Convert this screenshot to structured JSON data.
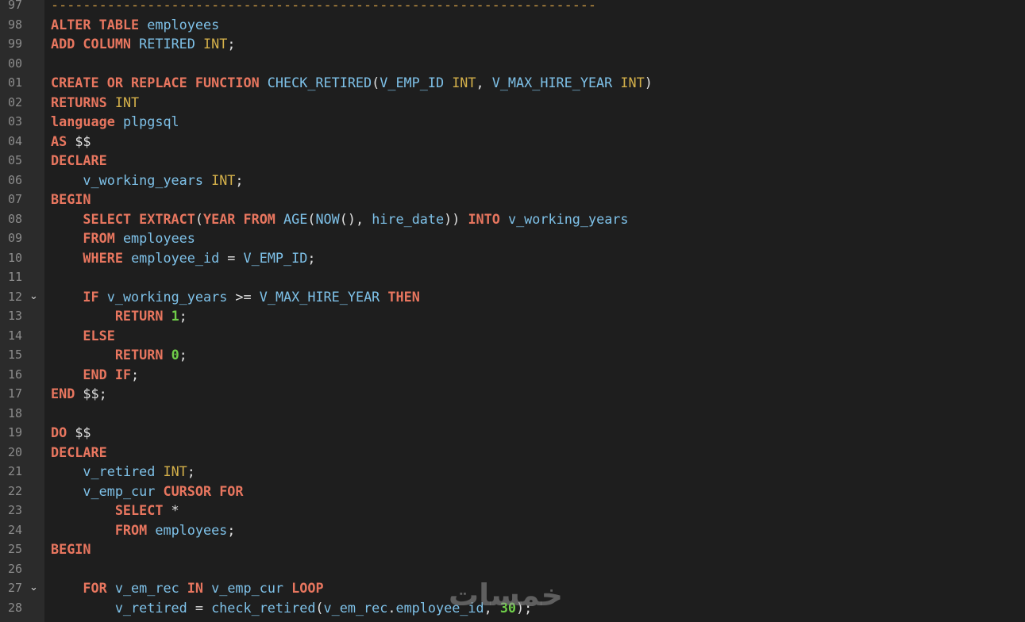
{
  "editor": {
    "colors": {
      "background": "#1e1e1e",
      "gutter": "#2b2b2b",
      "keyword": "#e8765f",
      "type": "#d4b04a",
      "identifier": "#7ec1e8",
      "number": "#6fce49",
      "plain": "#e0e0e0",
      "comment": "#cc9944"
    },
    "fold_icon": "chevron-down-icon",
    "lines": [
      {
        "n": "97",
        "fold": false,
        "tokens": [
          {
            "t": "cm",
            "v": "--------------------------------------------------------------------"
          }
        ]
      },
      {
        "n": "98",
        "fold": false,
        "tokens": [
          {
            "t": "kw",
            "v": "ALTER TABLE"
          },
          {
            "t": "pl",
            "v": " "
          },
          {
            "t": "id",
            "v": "employees"
          }
        ]
      },
      {
        "n": "99",
        "fold": false,
        "tokens": [
          {
            "t": "kw",
            "v": "ADD COLUMN"
          },
          {
            "t": "pl",
            "v": " "
          },
          {
            "t": "id",
            "v": "RETIRED"
          },
          {
            "t": "pl",
            "v": " "
          },
          {
            "t": "ty",
            "v": "INT"
          },
          {
            "t": "pl",
            "v": ";"
          }
        ]
      },
      {
        "n": "00",
        "fold": false,
        "tokens": []
      },
      {
        "n": "01",
        "fold": false,
        "tokens": [
          {
            "t": "kw",
            "v": "CREATE OR REPLACE FUNCTION"
          },
          {
            "t": "pl",
            "v": " "
          },
          {
            "t": "id",
            "v": "CHECK_RETIRED"
          },
          {
            "t": "pl",
            "v": "("
          },
          {
            "t": "id",
            "v": "V_EMP_ID"
          },
          {
            "t": "pl",
            "v": " "
          },
          {
            "t": "ty",
            "v": "INT"
          },
          {
            "t": "pl",
            "v": ", "
          },
          {
            "t": "id",
            "v": "V_MAX_HIRE_YEAR"
          },
          {
            "t": "pl",
            "v": " "
          },
          {
            "t": "ty",
            "v": "INT"
          },
          {
            "t": "pl",
            "v": ")"
          }
        ]
      },
      {
        "n": "02",
        "fold": false,
        "tokens": [
          {
            "t": "kw",
            "v": "RETURNS"
          },
          {
            "t": "pl",
            "v": " "
          },
          {
            "t": "ty",
            "v": "INT"
          }
        ]
      },
      {
        "n": "03",
        "fold": false,
        "tokens": [
          {
            "t": "kw",
            "v": "language"
          },
          {
            "t": "pl",
            "v": " "
          },
          {
            "t": "id",
            "v": "plpgsql"
          }
        ]
      },
      {
        "n": "04",
        "fold": false,
        "tokens": [
          {
            "t": "kw",
            "v": "AS"
          },
          {
            "t": "pl",
            "v": " $$"
          }
        ]
      },
      {
        "n": "05",
        "fold": false,
        "tokens": [
          {
            "t": "kw",
            "v": "DECLARE"
          }
        ]
      },
      {
        "n": "06",
        "fold": false,
        "tokens": [
          {
            "t": "pl",
            "v": "    "
          },
          {
            "t": "id",
            "v": "v_working_years"
          },
          {
            "t": "pl",
            "v": " "
          },
          {
            "t": "ty",
            "v": "INT"
          },
          {
            "t": "pl",
            "v": ";"
          }
        ]
      },
      {
        "n": "07",
        "fold": false,
        "tokens": [
          {
            "t": "kw",
            "v": "BEGIN"
          }
        ]
      },
      {
        "n": "08",
        "fold": false,
        "tokens": [
          {
            "t": "pl",
            "v": "    "
          },
          {
            "t": "kw",
            "v": "SELECT EXTRACT"
          },
          {
            "t": "pl",
            "v": "("
          },
          {
            "t": "kw",
            "v": "YEAR FROM"
          },
          {
            "t": "pl",
            "v": " "
          },
          {
            "t": "id",
            "v": "AGE"
          },
          {
            "t": "pl",
            "v": "("
          },
          {
            "t": "id",
            "v": "NOW"
          },
          {
            "t": "pl",
            "v": "(), "
          },
          {
            "t": "id",
            "v": "hire_date"
          },
          {
            "t": "pl",
            "v": ")) "
          },
          {
            "t": "kw",
            "v": "INTO"
          },
          {
            "t": "pl",
            "v": " "
          },
          {
            "t": "id",
            "v": "v_working_years"
          }
        ]
      },
      {
        "n": "09",
        "fold": false,
        "tokens": [
          {
            "t": "pl",
            "v": "    "
          },
          {
            "t": "kw",
            "v": "FROM"
          },
          {
            "t": "pl",
            "v": " "
          },
          {
            "t": "id",
            "v": "employees"
          }
        ]
      },
      {
        "n": "10",
        "fold": false,
        "tokens": [
          {
            "t": "pl",
            "v": "    "
          },
          {
            "t": "kw",
            "v": "WHERE"
          },
          {
            "t": "pl",
            "v": " "
          },
          {
            "t": "id",
            "v": "employee_id"
          },
          {
            "t": "pl",
            "v": " = "
          },
          {
            "t": "id",
            "v": "V_EMP_ID"
          },
          {
            "t": "pl",
            "v": ";"
          }
        ]
      },
      {
        "n": "11",
        "fold": false,
        "tokens": []
      },
      {
        "n": "12",
        "fold": true,
        "tokens": [
          {
            "t": "pl",
            "v": "    "
          },
          {
            "t": "kw",
            "v": "IF"
          },
          {
            "t": "pl",
            "v": " "
          },
          {
            "t": "id",
            "v": "v_working_years"
          },
          {
            "t": "pl",
            "v": " >= "
          },
          {
            "t": "id",
            "v": "V_MAX_HIRE_YEAR"
          },
          {
            "t": "pl",
            "v": " "
          },
          {
            "t": "kw",
            "v": "THEN"
          }
        ]
      },
      {
        "n": "13",
        "fold": false,
        "tokens": [
          {
            "t": "pl",
            "v": "        "
          },
          {
            "t": "kw",
            "v": "RETURN"
          },
          {
            "t": "pl",
            "v": " "
          },
          {
            "t": "num",
            "v": "1"
          },
          {
            "t": "pl",
            "v": ";"
          }
        ]
      },
      {
        "n": "14",
        "fold": false,
        "tokens": [
          {
            "t": "pl",
            "v": "    "
          },
          {
            "t": "kw",
            "v": "ELSE"
          }
        ]
      },
      {
        "n": "15",
        "fold": false,
        "tokens": [
          {
            "t": "pl",
            "v": "        "
          },
          {
            "t": "kw",
            "v": "RETURN"
          },
          {
            "t": "pl",
            "v": " "
          },
          {
            "t": "num",
            "v": "0"
          },
          {
            "t": "pl",
            "v": ";"
          }
        ]
      },
      {
        "n": "16",
        "fold": false,
        "tokens": [
          {
            "t": "pl",
            "v": "    "
          },
          {
            "t": "kw",
            "v": "END IF"
          },
          {
            "t": "pl",
            "v": ";"
          }
        ]
      },
      {
        "n": "17",
        "fold": false,
        "tokens": [
          {
            "t": "kw",
            "v": "END"
          },
          {
            "t": "pl",
            "v": " $$;"
          }
        ]
      },
      {
        "n": "18",
        "fold": false,
        "tokens": []
      },
      {
        "n": "19",
        "fold": false,
        "tokens": [
          {
            "t": "kw",
            "v": "DO"
          },
          {
            "t": "pl",
            "v": " $$"
          }
        ]
      },
      {
        "n": "20",
        "fold": false,
        "tokens": [
          {
            "t": "kw",
            "v": "DECLARE"
          }
        ]
      },
      {
        "n": "21",
        "fold": false,
        "tokens": [
          {
            "t": "pl",
            "v": "    "
          },
          {
            "t": "id",
            "v": "v_retired"
          },
          {
            "t": "pl",
            "v": " "
          },
          {
            "t": "ty",
            "v": "INT"
          },
          {
            "t": "pl",
            "v": ";"
          }
        ]
      },
      {
        "n": "22",
        "fold": false,
        "tokens": [
          {
            "t": "pl",
            "v": "    "
          },
          {
            "t": "id",
            "v": "v_emp_cur"
          },
          {
            "t": "pl",
            "v": " "
          },
          {
            "t": "kw",
            "v": "CURSOR FOR"
          }
        ]
      },
      {
        "n": "23",
        "fold": false,
        "tokens": [
          {
            "t": "pl",
            "v": "        "
          },
          {
            "t": "kw",
            "v": "SELECT"
          },
          {
            "t": "pl",
            "v": " *"
          }
        ]
      },
      {
        "n": "24",
        "fold": false,
        "tokens": [
          {
            "t": "pl",
            "v": "        "
          },
          {
            "t": "kw",
            "v": "FROM"
          },
          {
            "t": "pl",
            "v": " "
          },
          {
            "t": "id",
            "v": "employees"
          },
          {
            "t": "pl",
            "v": ";"
          }
        ]
      },
      {
        "n": "25",
        "fold": false,
        "tokens": [
          {
            "t": "kw",
            "v": "BEGIN"
          }
        ]
      },
      {
        "n": "26",
        "fold": false,
        "tokens": []
      },
      {
        "n": "27",
        "fold": true,
        "tokens": [
          {
            "t": "pl",
            "v": "    "
          },
          {
            "t": "kw",
            "v": "FOR"
          },
          {
            "t": "pl",
            "v": " "
          },
          {
            "t": "id",
            "v": "v_em_rec"
          },
          {
            "t": "pl",
            "v": " "
          },
          {
            "t": "kw",
            "v": "IN"
          },
          {
            "t": "pl",
            "v": " "
          },
          {
            "t": "id",
            "v": "v_emp_cur"
          },
          {
            "t": "pl",
            "v": " "
          },
          {
            "t": "kw",
            "v": "LOOP"
          }
        ]
      },
      {
        "n": "28",
        "fold": false,
        "tokens": [
          {
            "t": "pl",
            "v": "        "
          },
          {
            "t": "id",
            "v": "v_retired"
          },
          {
            "t": "pl",
            "v": " = "
          },
          {
            "t": "id",
            "v": "check_retired"
          },
          {
            "t": "pl",
            "v": "("
          },
          {
            "t": "id",
            "v": "v_em_rec"
          },
          {
            "t": "pl",
            "v": "."
          },
          {
            "t": "id",
            "v": "employee_id"
          },
          {
            "t": "pl",
            "v": ", "
          },
          {
            "t": "num",
            "v": "30"
          },
          {
            "t": "pl",
            "v": ");"
          }
        ]
      }
    ]
  },
  "watermark": {
    "text": "خمسات"
  }
}
